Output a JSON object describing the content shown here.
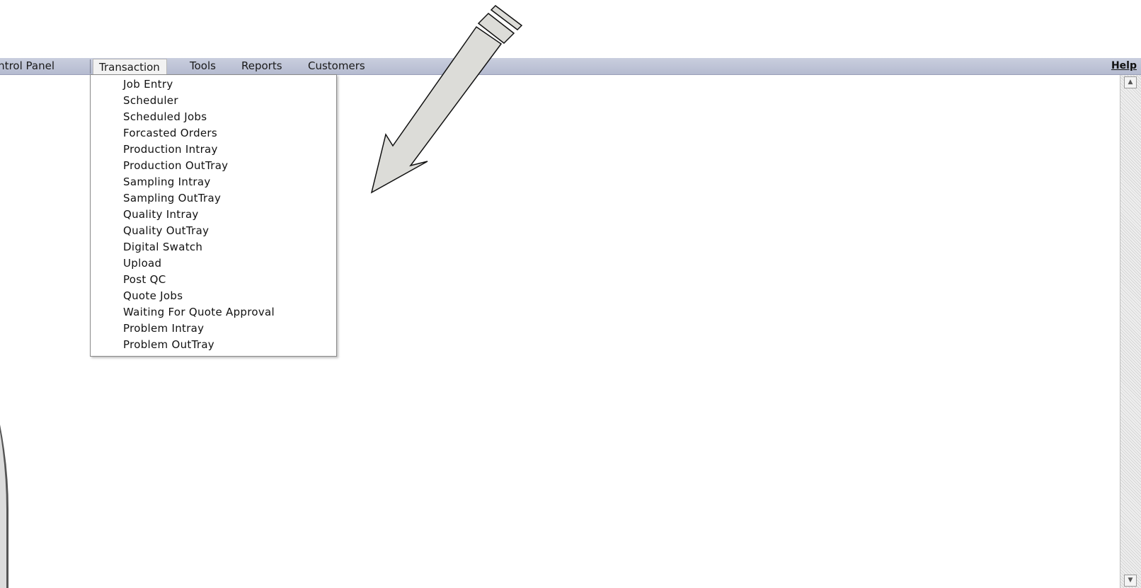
{
  "menubar": {
    "items": [
      {
        "label": "ontrol Panel"
      },
      {
        "label": "Transaction"
      },
      {
        "label": "Tools"
      },
      {
        "label": "Reports"
      },
      {
        "label": "Customers"
      }
    ],
    "help_label": "Help"
  },
  "dropdown": {
    "items": [
      {
        "label": "Job Entry"
      },
      {
        "label": "Scheduler"
      },
      {
        "label": "Scheduled Jobs"
      },
      {
        "label": "Forcasted Orders"
      },
      {
        "label": "Production Intray"
      },
      {
        "label": "Production OutTray"
      },
      {
        "label": "Sampling Intray"
      },
      {
        "label": "Sampling OutTray"
      },
      {
        "label": "Quality Intray"
      },
      {
        "label": "Quality OutTray"
      },
      {
        "label": "Digital Swatch"
      },
      {
        "label": "Upload"
      },
      {
        "label": "Post QC"
      },
      {
        "label": "Quote Jobs"
      },
      {
        "label": "Waiting For Quote Approval"
      },
      {
        "label": "Problem Intray"
      },
      {
        "label": "Problem OutTray"
      }
    ]
  },
  "scrollbar": {
    "up_icon": "scroll-up-arrow-icon",
    "down_icon": "scroll-down-arrow-icon"
  },
  "annotation": {
    "icon": "pointer-arrow-icon",
    "fill_color": "#dcdcd8",
    "stroke_color": "#111111"
  }
}
